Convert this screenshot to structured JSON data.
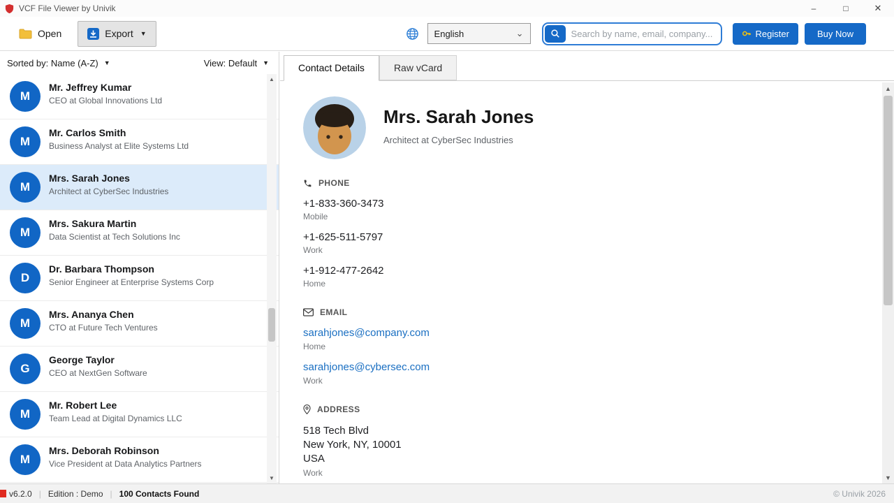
{
  "window": {
    "title": "VCF File Viewer by Univik"
  },
  "icons": {
    "dropdown_arrow": "▼",
    "select_chevron": "⌄",
    "minimize": "–",
    "maximize": "□",
    "close": "✕",
    "scroll_up": "▲",
    "scroll_down": "▼"
  },
  "toolbar": {
    "open": "Open",
    "export": "Export",
    "language_selected": "English",
    "search_placeholder": "Search by name, email, company...",
    "register": "Register",
    "buy_now": "Buy Now"
  },
  "list_header": {
    "sorted_by": "Sorted by: Name (A-Z)",
    "view": "View: Default"
  },
  "contacts": [
    {
      "initial": "M",
      "name": "Mr. Jeffrey Kumar",
      "subtitle": "CEO at Global Innovations Ltd",
      "selected": false
    },
    {
      "initial": "M",
      "name": "Mr. Carlos Smith",
      "subtitle": "Business Analyst at Elite Systems Ltd",
      "selected": false
    },
    {
      "initial": "M",
      "name": "Mrs. Sarah Jones",
      "subtitle": "Architect at CyberSec Industries",
      "selected": true
    },
    {
      "initial": "M",
      "name": "Mrs. Sakura Martin",
      "subtitle": "Data Scientist at Tech Solutions Inc",
      "selected": false
    },
    {
      "initial": "D",
      "name": "Dr. Barbara Thompson",
      "subtitle": "Senior Engineer at Enterprise Systems Corp",
      "selected": false
    },
    {
      "initial": "M",
      "name": "Mrs. Ananya Chen",
      "subtitle": "CTO at Future Tech Ventures",
      "selected": false
    },
    {
      "initial": "G",
      "name": "George Taylor",
      "subtitle": "CEO at NextGen Software",
      "selected": false
    },
    {
      "initial": "M",
      "name": "Mr. Robert Lee",
      "subtitle": "Team Lead at Digital Dynamics LLC",
      "selected": false
    },
    {
      "initial": "M",
      "name": "Mrs. Deborah Robinson",
      "subtitle": "Vice President at Data Analytics Partners",
      "selected": false
    }
  ],
  "tabs": [
    {
      "label": "Contact Details",
      "active": true
    },
    {
      "label": "Raw vCard",
      "active": false
    }
  ],
  "detail": {
    "name": "Mrs. Sarah Jones",
    "title": "Architect at CyberSec Industries",
    "sections": {
      "phone": {
        "heading": "PHONE",
        "items": [
          {
            "value": "+1-833-360-3473",
            "label": "Mobile"
          },
          {
            "value": "+1-625-511-5797",
            "label": "Work"
          },
          {
            "value": "+1-912-477-2642",
            "label": "Home"
          }
        ]
      },
      "email": {
        "heading": "EMAIL",
        "items": [
          {
            "value": "sarahjones@company.com",
            "label": "Home"
          },
          {
            "value": "sarahjones@cybersec.com",
            "label": "Work"
          }
        ]
      },
      "address": {
        "heading": "ADDRESS",
        "lines": [
          "518 Tech Blvd",
          "New York, NY, 10001",
          "USA"
        ],
        "label": "Work"
      }
    }
  },
  "status": {
    "version": "v6.2.0",
    "edition": "Edition : Demo",
    "contacts_found": "100 Contacts Found",
    "copyright": "© Univik 2026"
  },
  "colors": {
    "accent_blue": "#1569c7",
    "avatar_blue": "#1166c5",
    "selected_row": "#dcebfa",
    "link_blue": "#1a6fc2",
    "logo_red": "#d32f2f",
    "search_border": "#2e7cd6"
  }
}
